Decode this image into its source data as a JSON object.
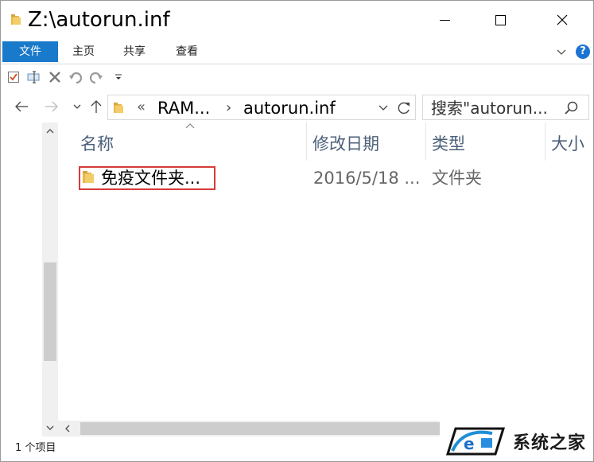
{
  "window": {
    "title": "Z:\\autorun.inf"
  },
  "ribbon": {
    "tabs": [
      {
        "label": "文件"
      },
      {
        "label": "主页"
      },
      {
        "label": "共享"
      },
      {
        "label": "查看"
      }
    ],
    "help_label": "?"
  },
  "addressbar": {
    "overflow": "«",
    "crumbs": [
      "RAM...",
      "autorun.inf"
    ],
    "crumb_separator": "›"
  },
  "search": {
    "placeholder": "搜索\"autorun...",
    "icon": "search-icon"
  },
  "columns": [
    {
      "label": "名称"
    },
    {
      "label": "修改日期"
    },
    {
      "label": "类型"
    },
    {
      "label": "大小"
    }
  ],
  "files": [
    {
      "name": "免疫文件夹...",
      "modified": "2016/5/18 ...",
      "type": "文件夹",
      "highlighted": true
    }
  ],
  "status": {
    "item_count": "1 个项目"
  },
  "watermark": {
    "text": "系统之家"
  },
  "colors": {
    "file_tab": "#1979ca",
    "highlight_border": "#d43c3c",
    "header_text": "#4c607a",
    "folder_yellow": "#e8b84b"
  }
}
